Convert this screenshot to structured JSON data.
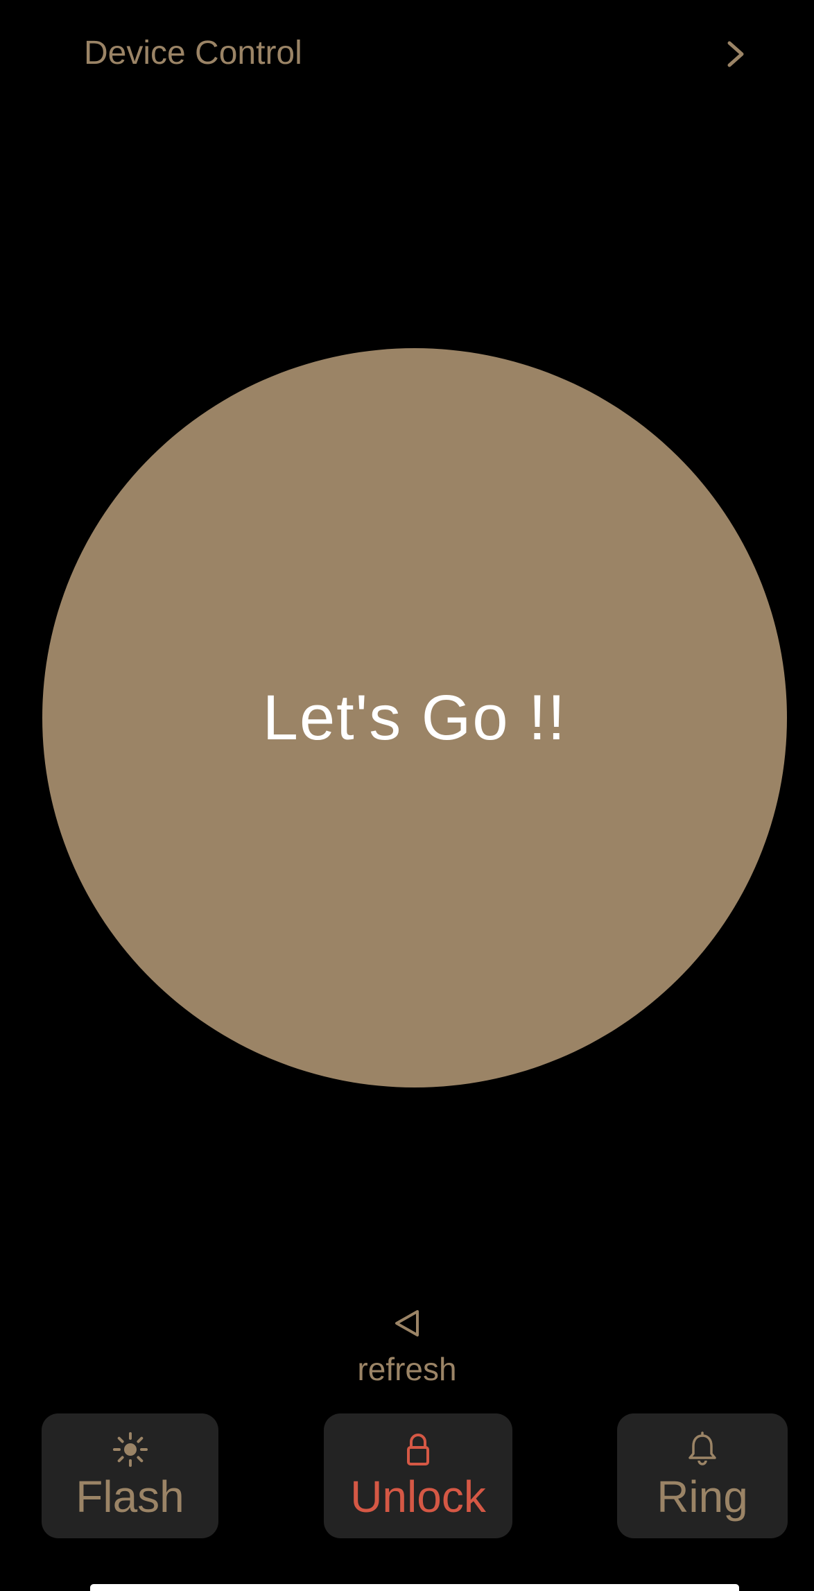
{
  "header": {
    "title": "Device Control",
    "chevron_icon": "chevron-right-icon"
  },
  "main": {
    "go_button_label": "Let's  Go !!"
  },
  "refresh": {
    "icon": "triangle-left-icon",
    "label": "refresh"
  },
  "actions": [
    {
      "label": "Flash",
      "icon": "sun-icon"
    },
    {
      "label": "Unlock",
      "icon": "lock-icon"
    },
    {
      "label": "Ring",
      "icon": "bell-icon"
    }
  ],
  "colors": {
    "background": "#000000",
    "accent": "#9b8466",
    "button_bg": "#232323",
    "unlock_red": "#d55845",
    "text_white": "#ffffff"
  }
}
